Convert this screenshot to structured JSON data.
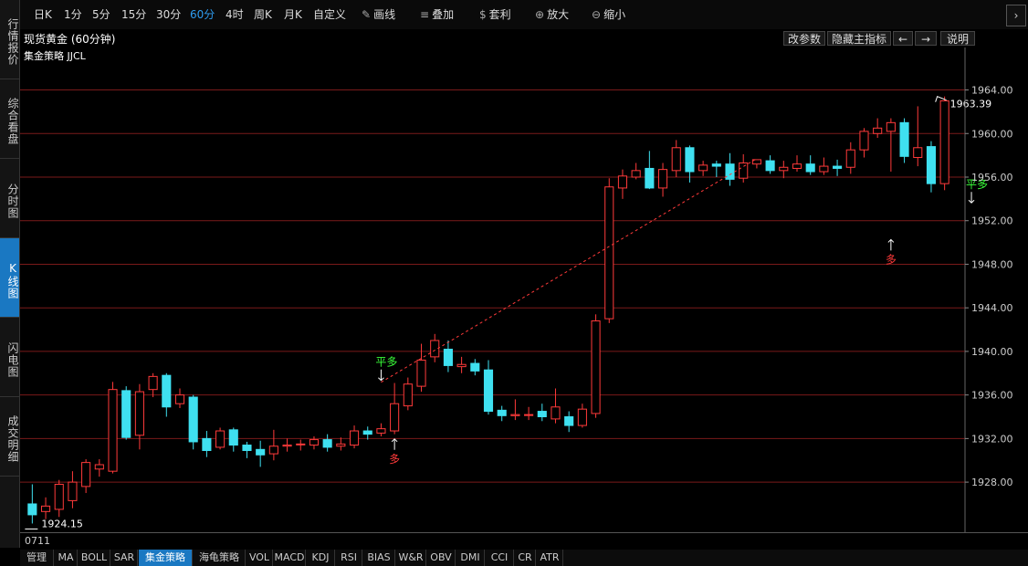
{
  "sidebar": {
    "tabs": [
      {
        "label": "行情报价",
        "active": false
      },
      {
        "label": "综合看盘",
        "active": false
      },
      {
        "label": "分时图",
        "active": false
      },
      {
        "label": "K线图",
        "active": true
      },
      {
        "label": "闪电图",
        "active": false
      },
      {
        "label": "成交明细",
        "active": false
      }
    ]
  },
  "toolbar": {
    "periods": [
      "日K",
      "1分",
      "5分",
      "15分",
      "30分",
      "60分",
      "4时",
      "周K",
      "月K",
      "自定义"
    ],
    "active_period": "60分",
    "tools": [
      {
        "label": "画线",
        "icon": "pencil-icon"
      },
      {
        "label": "叠加",
        "icon": "stack-icon"
      },
      {
        "label": "套利",
        "icon": "money-bag-icon"
      },
      {
        "label": "放大",
        "icon": "zoom-in-icon"
      },
      {
        "label": "缩小",
        "icon": "zoom-out-icon"
      }
    ],
    "next_icon": "chevron-right-icon"
  },
  "header": {
    "instrument": "现货黄金 (60分钟)",
    "buttons": [
      "改参数",
      "隐藏主指标",
      "←",
      "→",
      "说明"
    ]
  },
  "strategy_label": "集金策略 JJCL",
  "date_label": "0711",
  "bottom_tabs": [
    "管理",
    "MA",
    "BOLL",
    "SAR",
    "集金策略",
    "海龟策略",
    "VOL",
    "MACD",
    "KDJ",
    "RSI",
    "BIAS",
    "W&R",
    "OBV",
    "DMI",
    "CCI",
    "CR",
    "ATR"
  ],
  "active_bottom_tab": "集金策略",
  "colors": {
    "up": "#ff3a3a",
    "down": "#3fe0f0",
    "grid": "#7a1a1a",
    "signal_long": "#ff3a3a",
    "signal_flat": "#3aff3a"
  },
  "chart_data": {
    "type": "candlestick",
    "y_ticks": [
      1964,
      1960,
      1956,
      1952,
      1948,
      1944,
      1940,
      1936,
      1932,
      1928
    ],
    "y_tick_labels": [
      "1964.00",
      "1960.00",
      "1956.00",
      "1952.00",
      "1948.00",
      "1944.00",
      "1940.00",
      "1936.00",
      "1932.00",
      "1928.00"
    ],
    "ylim": [
      1923.4,
      1967.9
    ],
    "high_label": "1963.39",
    "low_label": "1924.15",
    "annotations": [
      {
        "text": "多",
        "kind": "long",
        "index": 27,
        "price": 1932.3
      },
      {
        "text": "平多",
        "kind": "flat",
        "index": 26,
        "price": 1937.0
      },
      {
        "text": "多",
        "kind": "long",
        "index": 64,
        "price": 1950.6
      },
      {
        "text": "平多",
        "kind": "flat",
        "index": 70,
        "price": 1953.3
      }
    ],
    "candles": [
      [
        1926.0,
        1925.0,
        1927.8,
        1924.2
      ],
      [
        1925.3,
        1925.8,
        1926.6,
        1924.6
      ],
      [
        1925.5,
        1927.8,
        1928.2,
        1924.8
      ],
      [
        1926.3,
        1928.0,
        1929.0,
        1925.6
      ],
      [
        1927.6,
        1929.8,
        1930.1,
        1927.0
      ],
      [
        1929.2,
        1929.6,
        1930.1,
        1928.5
      ],
      [
        1929.0,
        1936.5,
        1937.2,
        1928.8
      ],
      [
        1936.4,
        1932.1,
        1936.8,
        1931.9
      ],
      [
        1932.3,
        1936.3,
        1937.0,
        1931.0
      ],
      [
        1936.5,
        1937.7,
        1938.0,
        1935.8
      ],
      [
        1937.8,
        1934.9,
        1938.0,
        1934.0
      ],
      [
        1935.2,
        1936.0,
        1936.6,
        1934.8
      ],
      [
        1935.8,
        1931.7,
        1936.0,
        1931.0
      ],
      [
        1932.0,
        1930.9,
        1932.7,
        1930.3
      ],
      [
        1931.2,
        1932.7,
        1933.0,
        1931.0
      ],
      [
        1932.8,
        1931.4,
        1933.0,
        1930.8
      ],
      [
        1931.4,
        1930.9,
        1931.7,
        1930.2
      ],
      [
        1931.0,
        1930.5,
        1931.8,
        1929.4
      ],
      [
        1930.6,
        1931.3,
        1932.8,
        1930.0
      ],
      [
        1931.3,
        1931.4,
        1932.0,
        1930.8
      ],
      [
        1931.5,
        1931.5,
        1931.9,
        1930.9
      ],
      [
        1931.4,
        1931.9,
        1932.2,
        1931.0
      ],
      [
        1931.9,
        1931.2,
        1932.4,
        1930.8
      ],
      [
        1931.3,
        1931.5,
        1932.1,
        1930.9
      ],
      [
        1931.4,
        1932.7,
        1933.2,
        1931.1
      ],
      [
        1932.7,
        1932.4,
        1933.1,
        1931.9
      ],
      [
        1932.5,
        1932.9,
        1933.4,
        1932.2
      ],
      [
        1932.7,
        1935.2,
        1937.1,
        1932.4
      ],
      [
        1935.0,
        1937.0,
        1937.6,
        1934.6
      ],
      [
        1936.8,
        1939.2,
        1940.7,
        1936.3
      ],
      [
        1939.5,
        1941.0,
        1941.6,
        1939.0
      ],
      [
        1940.2,
        1938.7,
        1941.0,
        1938.1
      ],
      [
        1938.6,
        1938.8,
        1939.5,
        1938.0
      ],
      [
        1938.9,
        1938.2,
        1939.3,
        1937.8
      ],
      [
        1938.3,
        1934.5,
        1939.2,
        1934.2
      ],
      [
        1934.6,
        1934.1,
        1935.0,
        1933.6
      ],
      [
        1934.1,
        1934.2,
        1935.6,
        1933.7
      ],
      [
        1934.2,
        1934.2,
        1934.9,
        1933.7
      ],
      [
        1934.5,
        1934.0,
        1935.2,
        1933.6
      ],
      [
        1933.8,
        1934.9,
        1936.6,
        1933.4
      ],
      [
        1934.0,
        1933.2,
        1934.5,
        1932.6
      ],
      [
        1933.2,
        1934.7,
        1935.2,
        1933.0
      ],
      [
        1934.3,
        1942.8,
        1943.4,
        1933.9
      ],
      [
        1943.0,
        1955.1,
        1955.9,
        1942.6
      ],
      [
        1955.0,
        1956.1,
        1956.7,
        1954.0
      ],
      [
        1956.0,
        1956.6,
        1957.3,
        1955.8
      ],
      [
        1956.8,
        1955.0,
        1958.4,
        1954.9
      ],
      [
        1955.0,
        1956.7,
        1957.3,
        1954.2
      ],
      [
        1956.6,
        1958.7,
        1959.4,
        1956.0
      ],
      [
        1958.7,
        1956.5,
        1958.9,
        1955.5
      ],
      [
        1956.6,
        1957.1,
        1957.5,
        1956.1
      ],
      [
        1957.2,
        1957.0,
        1957.5,
        1956.0
      ],
      [
        1957.2,
        1955.8,
        1958.2,
        1955.2
      ],
      [
        1955.9,
        1957.3,
        1958.1,
        1955.5
      ],
      [
        1957.2,
        1957.6,
        1957.6,
        1956.8
      ],
      [
        1957.5,
        1956.6,
        1958.0,
        1956.3
      ],
      [
        1956.6,
        1956.9,
        1957.5,
        1955.9
      ],
      [
        1956.8,
        1957.2,
        1958.0,
        1956.5
      ],
      [
        1957.2,
        1956.5,
        1958.0,
        1956.2
      ],
      [
        1956.5,
        1957.0,
        1957.8,
        1956.2
      ],
      [
        1957.0,
        1956.8,
        1957.6,
        1956.1
      ],
      [
        1956.9,
        1958.5,
        1959.2,
        1956.3
      ],
      [
        1958.5,
        1960.2,
        1960.5,
        1957.8
      ],
      [
        1960.0,
        1960.5,
        1961.4,
        1959.6
      ],
      [
        1960.2,
        1961.0,
        1961.4,
        1956.5
      ],
      [
        1961.0,
        1957.9,
        1961.4,
        1957.3
      ],
      [
        1957.8,
        1958.7,
        1962.5,
        1957.0
      ],
      [
        1958.8,
        1955.4,
        1959.3,
        1954.6
      ],
      [
        1955.4,
        1963.0,
        1963.4,
        1954.8
      ]
    ]
  }
}
